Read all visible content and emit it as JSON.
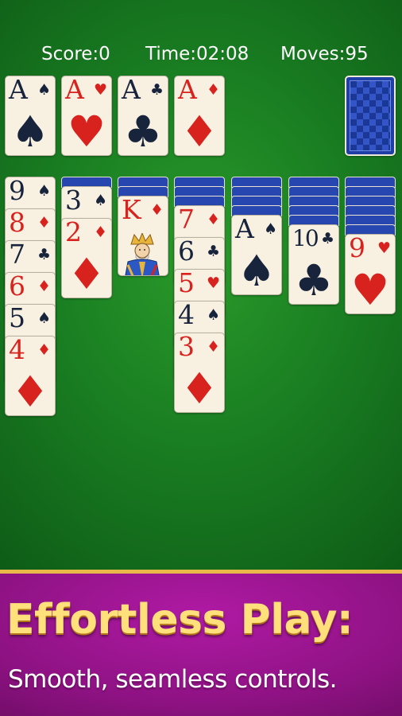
{
  "hud": {
    "score": "Score:0",
    "time": "Time:02:08",
    "moves": "Moves:95"
  },
  "foundations": [
    {
      "rank": "A",
      "suit": "♠",
      "color": "black"
    },
    {
      "rank": "A",
      "suit": "♥",
      "color": "red"
    },
    {
      "rank": "A",
      "suit": "♣",
      "color": "black"
    },
    {
      "rank": "A",
      "suit": "♦",
      "color": "red"
    }
  ],
  "stock": {
    "face_down": true
  },
  "tableau": [
    {
      "hidden": 0,
      "cards": [
        {
          "rank": "9",
          "suit": "♠",
          "color": "black"
        },
        {
          "rank": "8",
          "suit": "♦",
          "color": "red"
        },
        {
          "rank": "7",
          "suit": "♣",
          "color": "black"
        },
        {
          "rank": "6",
          "suit": "♦",
          "color": "red"
        },
        {
          "rank": "5",
          "suit": "♠",
          "color": "black"
        },
        {
          "rank": "4",
          "suit": "♦",
          "color": "red"
        }
      ]
    },
    {
      "hidden": 1,
      "cards": [
        {
          "rank": "3",
          "suit": "♠",
          "color": "black"
        },
        {
          "rank": "2",
          "suit": "♦",
          "color": "red"
        }
      ]
    },
    {
      "hidden": 2,
      "cards": [
        {
          "rank": "K",
          "suit": "♦",
          "color": "red",
          "face": "king"
        }
      ]
    },
    {
      "hidden": 3,
      "cards": [
        {
          "rank": "7",
          "suit": "♦",
          "color": "red"
        },
        {
          "rank": "6",
          "suit": "♣",
          "color": "black"
        },
        {
          "rank": "5",
          "suit": "♥",
          "color": "red"
        },
        {
          "rank": "4",
          "suit": "♠",
          "color": "black"
        },
        {
          "rank": "3",
          "suit": "♦",
          "color": "red"
        }
      ]
    },
    {
      "hidden": 4,
      "cards": [
        {
          "rank": "A",
          "suit": "♠",
          "color": "black"
        }
      ]
    },
    {
      "hidden": 5,
      "cards": [
        {
          "rank": "10",
          "suit": "♣",
          "color": "black"
        }
      ]
    },
    {
      "hidden": 6,
      "cards": [
        {
          "rank": "9",
          "suit": "♥",
          "color": "red"
        }
      ]
    }
  ],
  "banner": {
    "title": "Effortless Play:",
    "subtitle": "Smooth, seamless controls."
  },
  "colors": {
    "felt": "#1a7f22",
    "card_face": "#f8f1e2",
    "card_back": "#1f3fa6",
    "red_suit": "#d8221e",
    "black_suit": "#17243c",
    "banner_bg": "#8e1283",
    "banner_title": "#ffe07a"
  }
}
